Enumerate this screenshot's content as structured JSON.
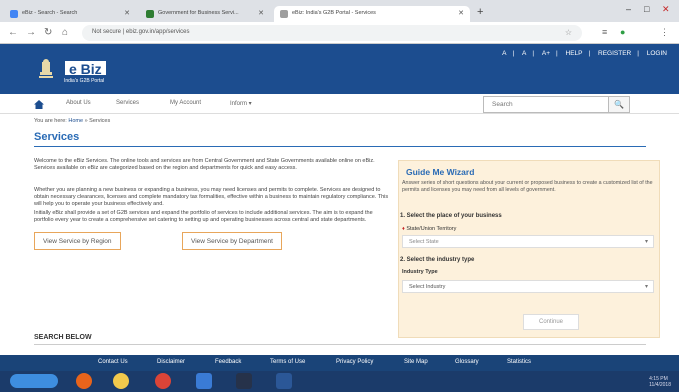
{
  "browser": {
    "tabs": [
      {
        "title": "eBiz - Search - Search",
        "fav_color": "#4285f4"
      },
      {
        "title": "Government for Business Servi...",
        "fav_color": "#2e7d32"
      },
      {
        "title": "eBiz: India's G2B Portal - Services",
        "fav_color": "#9e9e9e"
      }
    ],
    "new_tab": "+",
    "address": "Not secure | ebiz.gov.in/app/services",
    "window_controls": [
      "–",
      "□",
      "✕"
    ]
  },
  "site": {
    "logo_text": "e Biz",
    "logo_sub": "India's G2B Portal",
    "top_links": [
      "A",
      "A",
      "A+",
      "HELP",
      "REGISTER",
      "LOGIN"
    ]
  },
  "menu": {
    "items": [
      "About Us",
      "Services",
      "My Account",
      "Inform ▾"
    ],
    "search_placeholder": "Search"
  },
  "breadcrumb": {
    "prefix": "You are here:",
    "home": "Home",
    "current": "» Services"
  },
  "page_title": "Services",
  "paragraphs": [
    "Welcome to the eBiz Services. The online tools and services are from Central Government and State Governments available online on eBiz. Services available on eBiz are categorized based on the region and departments for quick and easy access.",
    "Whether you are planning a new business or expanding a business, you may need licenses and permits to complete. Services are designed to obtain necessary clearances, licenses and complete mandatory tax formalities, effective within a business to maintain regulatory compliance. This will help you to operate your business effectively and.",
    "Initially eBiz shall provide a set of G2B services and expand the portfolio of services to include additional services. The aim is to expand the portfolio every year to create a comprehensive set catering to setting up and operating businesses across central and state departments."
  ],
  "buttons": {
    "by_region": "View Service by Region",
    "by_department": "View Service by Department"
  },
  "wizard": {
    "title": "Guide Me Wizard",
    "intro": "Answer series of short questions about your current or proposed business to create a customized list of the permits and licenses you may need from all levels of government.",
    "step1": "1. Select the place of your business",
    "state_label": "State/Union Territory",
    "state_value": "Select State",
    "step2": "2. Select the industry type",
    "industry_label": "Industry Type",
    "industry_value": "Select Industry",
    "continue": "Continue"
  },
  "search_below": "SEARCH BELOW",
  "footer": [
    "Contact Us",
    "Disclaimer",
    "Feedback",
    "Terms of Use",
    "Privacy Policy",
    "Site Map",
    "Glossary",
    "Statistics"
  ],
  "taskbar": {
    "start_label": "",
    "apps": [
      {
        "name": "firefox",
        "color": "#e8641b"
      },
      {
        "name": "chrome-alt",
        "color": "#f2c94c"
      },
      {
        "name": "chrome",
        "color": "#db4437"
      },
      {
        "name": "explorer",
        "color": "#3a7bd5"
      },
      {
        "name": "terminal",
        "color": "#26324a"
      },
      {
        "name": "word",
        "color": "#2b5797"
      }
    ],
    "clock": "4:15 PM",
    "date": "11/4/2018"
  }
}
